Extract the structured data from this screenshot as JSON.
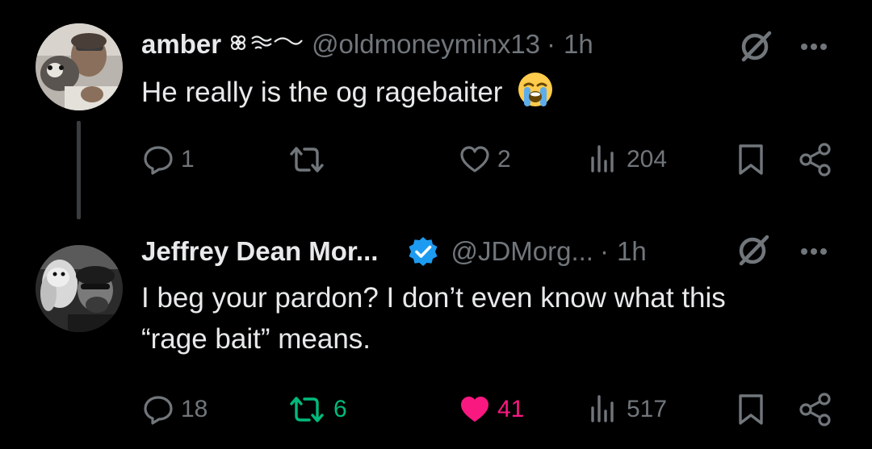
{
  "colors": {
    "background": "#000000",
    "text_primary": "#e7e9ea",
    "text_secondary": "#71767b",
    "verified_blue": "#1d9bf0",
    "retweet_green": "#00ba7c",
    "like_pink": "#f91880",
    "thread_line": "#3a3d40"
  },
  "tweets": [
    {
      "display_name": "amber",
      "name_emoji": "❀≋~",
      "handle": "@oldmoneyminx13",
      "separator": "·",
      "time": "1h",
      "text": "He really is the og ragebaiter",
      "text_emoji": "😭",
      "verified": false,
      "reply_count": "1",
      "retweet_count": "",
      "like_count": "2",
      "view_count": "204",
      "retweeted": false,
      "liked": false,
      "icons": [
        "avatar-photo",
        "grok-icon",
        "more-icon",
        "reply-icon",
        "retweet-icon",
        "heart-icon",
        "views-icon",
        "bookmark-icon",
        "share-icon"
      ]
    },
    {
      "display_name": "Jeffrey Dean Mor...",
      "handle": "@JDMorg...",
      "separator": "·",
      "time": "1h",
      "text_line1": "I beg your pardon? I don’t even know what this",
      "text_line2": "“rage bait” means.",
      "verified": true,
      "reply_count": "18",
      "retweet_count": "6",
      "like_count": "41",
      "view_count": "517",
      "retweeted": true,
      "liked": true,
      "icons": [
        "avatar-photo",
        "verified-badge-icon",
        "grok-icon",
        "more-icon",
        "reply-icon",
        "retweet-icon",
        "heart-filled-icon",
        "views-icon",
        "bookmark-icon",
        "share-icon"
      ]
    }
  ]
}
